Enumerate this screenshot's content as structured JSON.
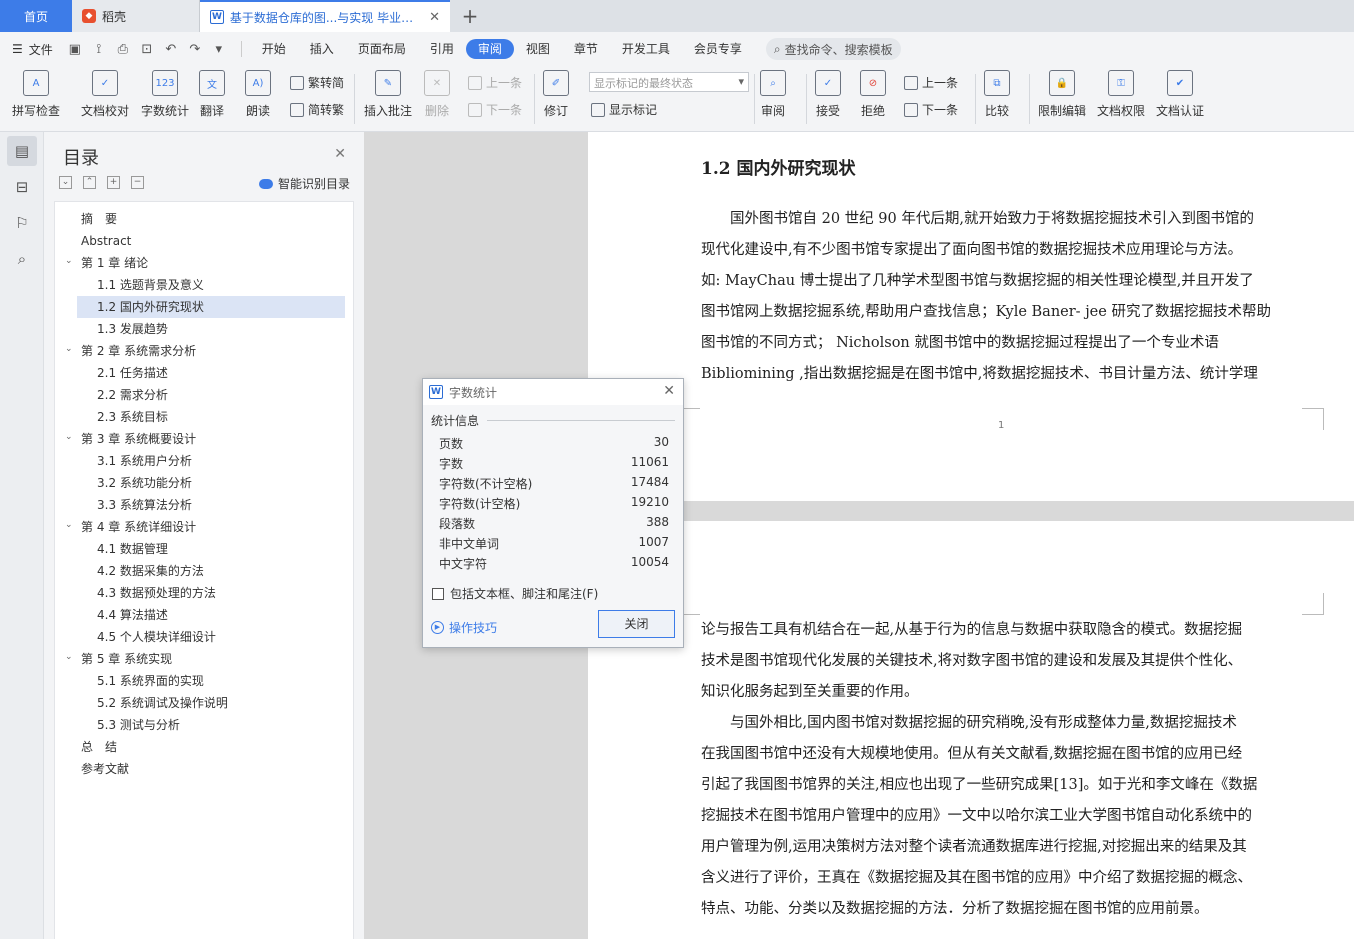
{
  "tabs": {
    "home": "首页",
    "daoke": "稻壳",
    "doc": "基于数据仓库的图...与实现 毕业论文"
  },
  "menu": {
    "file": "文件",
    "items": [
      "开始",
      "插入",
      "页面布局",
      "引用",
      "审阅",
      "视图",
      "章节",
      "开发工具",
      "会员专享"
    ],
    "active_index": 4,
    "search": "查找命令、搜索模板"
  },
  "ribbon": {
    "spell_check": "拼写检查",
    "doc_proof": "文档校对",
    "word_count": "字数统计",
    "translate": "翻译",
    "read_aloud": "朗读",
    "trad_to_simp": "繁转简",
    "simp_to_trad": "简转繁",
    "insert_comment": "插入批注",
    "delete": "删除",
    "prev": "上一条",
    "next": "下一条",
    "track_changes": "修订",
    "markup_select": "显示标记的最终状态",
    "show_markup": "显示标记",
    "review": "审阅",
    "accept": "接受",
    "reject": "拒绝",
    "prev2": "上一条",
    "next2": "下一条",
    "compare": "比较",
    "restrict_edit": "限制编辑",
    "doc_permission": "文档权限",
    "doc_cert": "文档认证"
  },
  "nav": {
    "title": "目录",
    "smart_toc": "智能识别目录",
    "items": [
      {
        "label": "摘　要",
        "level": 0
      },
      {
        "label": "Abstract",
        "level": 0
      },
      {
        "label": "第 1 章  绪论",
        "level": 0,
        "arrow": true
      },
      {
        "label": "1.1 选题背景及意义",
        "level": 1
      },
      {
        "label": "1.2 国内外研究现状",
        "level": 1,
        "selected": true
      },
      {
        "label": "1.3 发展趋势",
        "level": 1
      },
      {
        "label": "第 2 章  系统需求分析",
        "level": 0,
        "arrow": true
      },
      {
        "label": "2.1 任务描述",
        "level": 1
      },
      {
        "label": "2.2 需求分析",
        "level": 1
      },
      {
        "label": "2.3  系统目标",
        "level": 1
      },
      {
        "label": "第 3 章  系统概要设计",
        "level": 0,
        "arrow": true
      },
      {
        "label": "3.1  系统用户分析",
        "level": 1
      },
      {
        "label": "3.2   系统功能分析",
        "level": 1
      },
      {
        "label": "3.3  系统算法分析",
        "level": 1
      },
      {
        "label": "第 4 章  系统详细设计",
        "level": 0,
        "arrow": true
      },
      {
        "label": "4.1  数据管理",
        "level": 1
      },
      {
        "label": "4.2  数据采集的方法",
        "level": 1
      },
      {
        "label": "4.3  数据预处理的方法",
        "level": 1
      },
      {
        "label": "4.4  算法描述",
        "level": 1
      },
      {
        "label": "4.5  个人模块详细设计",
        "level": 1
      },
      {
        "label": "第 5 章  系统实现",
        "level": 0,
        "arrow": true
      },
      {
        "label": "5.1  系统界面的实现",
        "level": 1
      },
      {
        "label": "5.2  系统调试及操作说明",
        "level": 1
      },
      {
        "label": "5.3  测试与分析",
        "level": 1
      },
      {
        "label": "总　结",
        "level": 0
      },
      {
        "label": "参考文献",
        "level": 0
      }
    ]
  },
  "document": {
    "heading": "1.2 国内外研究现状",
    "page1_lines": [
      "　　国外图书馆自 20 世纪 90 年代后期,就开始致力于将数据挖掘技术引入到图书馆的",
      "现代化建设中,有不少图书馆专家提出了面向图书馆的数据挖掘技术应用理论与方法。",
      "如: MayChau  博士提出了几种学术型图书馆与数据挖掘的相关性理论模型,并且开发了",
      "图书馆网上数据挖掘系统,帮助用户查找信息；Kyle Baner- jee 研究了数据挖掘技术帮助",
      "图书馆的不同方式； Nicholson 就图书馆中的数据挖掘过程提出了一个专业术语",
      "Bibliomining ,指出数据挖掘是在图书馆中,将数据挖掘技术、书目计量方法、统计学理"
    ],
    "page_number": "1",
    "page2_lines": [
      "论与报告工具有机结合在一起,从基于行为的信息与数据中获取隐含的模式。数据挖掘",
      "技术是图书馆现代化发展的关键技术,将对数字图书馆的建设和发展及其提供个性化、",
      "知识化服务起到至关重要的作用。",
      "　　与国外相比,国内图书馆对数据挖掘的研究稍晚,没有形成整体力量,数据挖掘技术",
      "在我国图书馆中还没有大规模地使用。但从有关文献看,数据挖掘在图书馆的应用已经",
      "引起了我国图书馆界的关注,相应也出现了一些研究成果[13]。如于光和李文峰在《数据",
      "挖掘技术在图书馆用户管理中的应用》一文中以哈尔滨工业大学图书馆自动化系统中的",
      "用户管理为例,运用决策树方法对整个读者流通数据库进行挖掘,对挖掘出来的结果及其",
      "含义进行了评价，王真在《数据挖掘及其在图书馆的应用》中介绍了数据挖掘的概念、",
      "特点、功能、分类以及数据挖掘的方法．分析了数据挖掘在图书馆的应用前景。"
    ]
  },
  "dialog": {
    "title": "字数统计",
    "section": "统计信息",
    "rows": [
      {
        "label": "页数",
        "value": "30"
      },
      {
        "label": "字数",
        "value": "11061"
      },
      {
        "label": "字符数(不计空格)",
        "value": "17484"
      },
      {
        "label": "字符数(计空格)",
        "value": "19210"
      },
      {
        "label": "段落数",
        "value": "388"
      },
      {
        "label": "非中文单词",
        "value": "1007"
      },
      {
        "label": "中文字符",
        "value": "10054"
      }
    ],
    "include_label": "包括文本框、脚注和尾注(F)",
    "tips": "操作技巧",
    "close_button": "关闭"
  }
}
